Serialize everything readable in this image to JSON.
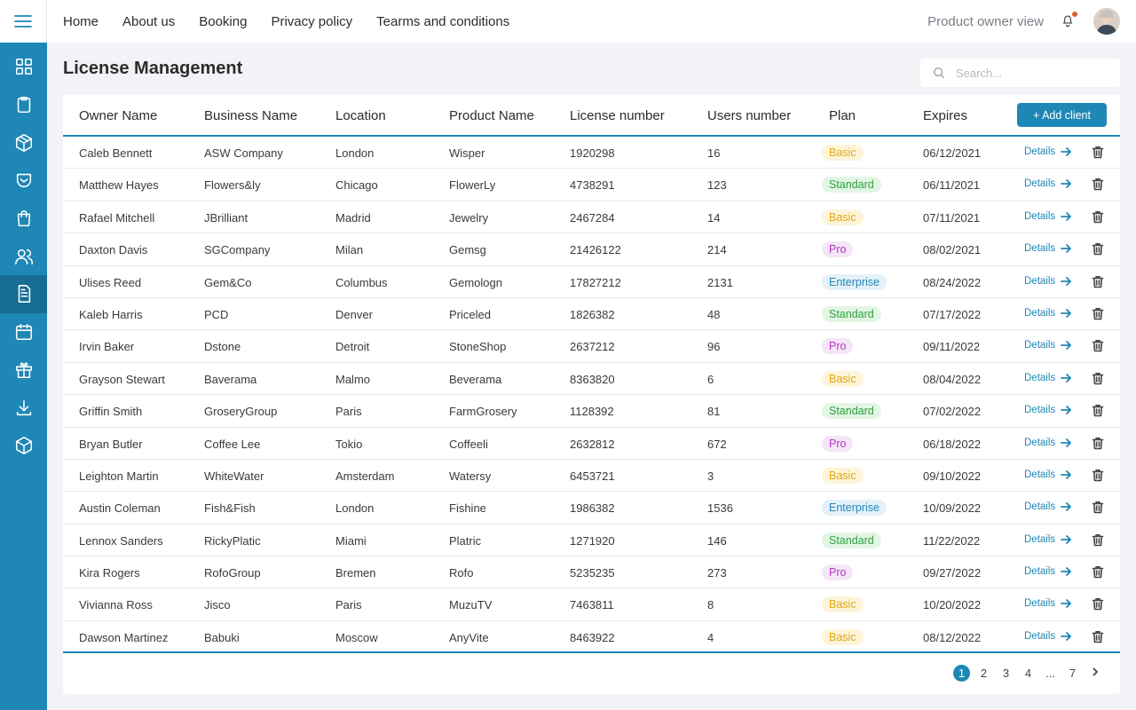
{
  "nav": {
    "items": [
      "Home",
      "About us",
      "Booking",
      "Privacy policy",
      "Tearms and conditions"
    ],
    "view_label": "Product owner view"
  },
  "page": {
    "title": "License Management",
    "search_placeholder": "Search..."
  },
  "table": {
    "headers": [
      "Owner Name",
      "Business Name",
      "Location",
      "Product Name",
      "License number",
      "Users number",
      "Plan",
      "Expires"
    ],
    "add_button": "+ Add client",
    "details_label": "Details",
    "rows": [
      [
        "Caleb Bennett",
        "ASW Company",
        "London",
        "Wisper",
        "1920298",
        "16",
        "Basic",
        "06/12/2021"
      ],
      [
        "Matthew Hayes",
        "Flowers&ly",
        "Chicago",
        "FlowerLy",
        "4738291",
        "123",
        "Standard",
        "06/11/2021"
      ],
      [
        "Rafael Mitchell",
        "JBrilliant",
        "Madrid",
        "Jewelry",
        "2467284",
        "14",
        "Basic",
        "07/11/2021"
      ],
      [
        "Daxton Davis",
        "SGCompany",
        "Milan",
        "Gemsg",
        "21426122",
        "214",
        "Pro",
        "08/02/2021"
      ],
      [
        "Ulises Reed",
        "Gem&Co",
        "Columbus",
        "Gemologn",
        "17827212",
        "2131",
        "Enterprise",
        "08/24/2022"
      ],
      [
        "Kaleb Harris",
        "PCD",
        "Denver",
        "Priceled",
        "1826382",
        "48",
        "Standard",
        "07/17/2022"
      ],
      [
        "Irvin Baker",
        "Dstone",
        "Detroit",
        "StoneShop",
        "2637212",
        "96",
        "Pro",
        "09/11/2022"
      ],
      [
        "Grayson Stewart",
        "Baverama",
        "Malmo",
        "Beverama",
        "8363820",
        "6",
        "Basic",
        "08/04/2022"
      ],
      [
        "Griffin Smith",
        "GroseryGroup",
        "Paris",
        "FarmGrosery",
        "1128392",
        "81",
        "Standard",
        "07/02/2022"
      ],
      [
        "Bryan Butler",
        "Coffee Lee",
        "Tokio",
        "Coffeeli",
        "2632812",
        "672",
        "Pro",
        "06/18/2022"
      ],
      [
        "Leighton Martin",
        "WhiteWater",
        "Amsterdam",
        "Watersy",
        "6453721",
        "3",
        "Basic",
        "09/10/2022"
      ],
      [
        "Austin Coleman",
        "Fish&Fish",
        "London",
        "Fishine",
        "1986382",
        "1536",
        "Enterprise",
        "10/09/2022"
      ],
      [
        "Lennox Sanders",
        "RickyPlatic",
        "Miami",
        "Platric",
        "1271920",
        "146",
        "Standard",
        "11/22/2022"
      ],
      [
        "Kira Rogers",
        "RofoGroup",
        "Bremen",
        "Rofo",
        "5235235",
        "273",
        "Pro",
        "09/27/2022"
      ],
      [
        "Vivianna Ross",
        "Jisco",
        "Paris",
        "MuzuTV",
        "7463811",
        "8",
        "Basic",
        "10/20/2022"
      ],
      [
        "Dawson Martinez",
        "Babuki",
        "Moscow",
        "AnyVite",
        "8463922",
        "4",
        "Basic",
        "08/12/2022"
      ]
    ]
  },
  "pagination": {
    "pages": [
      "1",
      "2",
      "3",
      "4",
      "...",
      "7"
    ],
    "current": "1"
  },
  "sidebar": {
    "icons": [
      "grid-icon",
      "clipboard-icon",
      "cube-icon",
      "shield-icon",
      "bag-icon",
      "users-icon",
      "document-icon",
      "calendar-icon",
      "gift-icon",
      "download-icon",
      "box-icon"
    ],
    "active_index": 6
  },
  "colors": {
    "accent": "#1e87b5",
    "basic": "#e2a712",
    "standard": "#2ca13c",
    "pro": "#b435c1",
    "enterprise": "#2488b8"
  }
}
